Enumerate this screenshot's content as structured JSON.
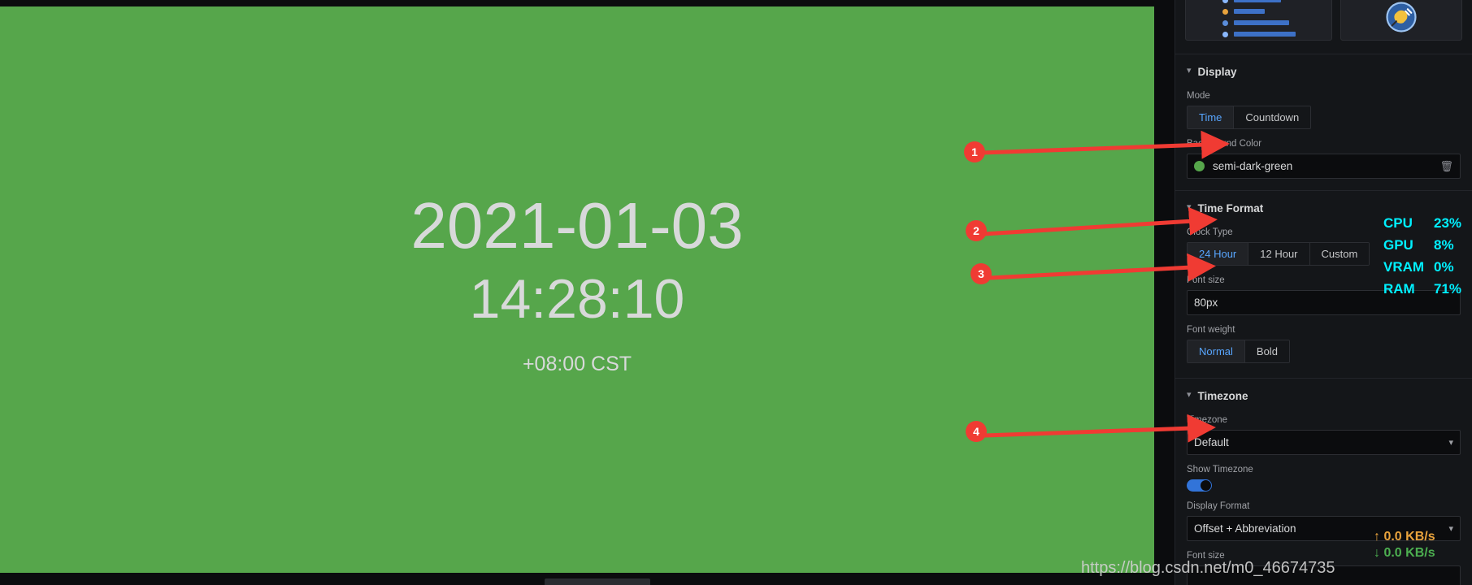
{
  "clock_panel": {
    "date": "2021-01-03",
    "time": "14:28:10",
    "timezone_label": "+08:00 CST",
    "background_color_hex": "#56a64b",
    "text_color_hex": "#d8d9da"
  },
  "options": {
    "viz_picker": {
      "option1_name": "bar-gauge-thumbnail",
      "option2_name": "plug-thumbnail"
    },
    "sections": [
      {
        "id": "display",
        "title": "Display",
        "fields": [
          {
            "id": "mode",
            "label": "Mode",
            "type": "radio",
            "options": [
              "Time",
              "Countdown"
            ],
            "value": "Time"
          },
          {
            "id": "background_color",
            "label": "Background Color",
            "type": "color",
            "value": "semi-dark-green",
            "swatch_hex": "#56a64b",
            "clear_icon": "trash-icon"
          }
        ]
      },
      {
        "id": "time_format",
        "title": "Time Format",
        "fields": [
          {
            "id": "clock_type",
            "label": "Clock Type",
            "type": "radio",
            "options": [
              "24 Hour",
              "12 Hour",
              "Custom"
            ],
            "value": "24 Hour"
          },
          {
            "id": "time_font_size",
            "label": "Font size",
            "type": "text",
            "value": "80px"
          },
          {
            "id": "time_font_weight",
            "label": "Font weight",
            "type": "radio",
            "options": [
              "Normal",
              "Bold"
            ],
            "value": "Normal"
          }
        ]
      },
      {
        "id": "timezone",
        "title": "Timezone",
        "fields": [
          {
            "id": "timezone_select",
            "label": "Timezone",
            "type": "select",
            "value": "Default"
          },
          {
            "id": "show_timezone",
            "label": "Show Timezone",
            "type": "toggle",
            "value": "on"
          },
          {
            "id": "display_format",
            "label": "Display Format",
            "type": "select",
            "value": "Offset + Abbreviation"
          },
          {
            "id": "tz_font_size",
            "label": "Font size",
            "type": "text",
            "value": ""
          }
        ]
      }
    ]
  },
  "stats_overlay": {
    "color_hex": "#00f0ff",
    "rows": [
      {
        "key": "CPU",
        "value": "23%"
      },
      {
        "key": "GPU",
        "value": "8%"
      },
      {
        "key": "VRAM",
        "value": "0%"
      },
      {
        "key": "RAM",
        "value": "71%"
      }
    ]
  },
  "network_overlay": {
    "upload": "0.0 KB/s",
    "download": "0.0 KB/s",
    "upload_icon": "arrow-up-icon",
    "download_icon": "arrow-down-icon",
    "upload_color_hex": "#e8a33d",
    "download_color_hex": "#4caf50"
  },
  "watermark": {
    "text": "https://blog.csdn.net/m0_46674735"
  },
  "annotations": {
    "marker_color_hex": "#f03b33",
    "markers": [
      {
        "number": "1",
        "target": "background-color-input"
      },
      {
        "number": "2",
        "target": "clock-type-24-hour"
      },
      {
        "number": "3",
        "target": "time-font-size-input"
      },
      {
        "number": "4",
        "target": "show-timezone-toggle"
      }
    ]
  }
}
